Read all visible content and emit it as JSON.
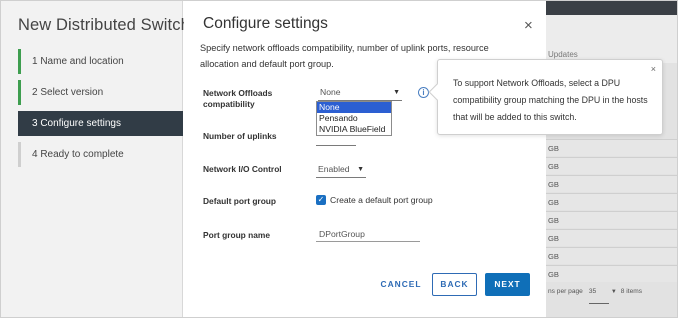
{
  "wizard": {
    "title": "New Distributed Switch",
    "steps": [
      {
        "label": "1  Name and location"
      },
      {
        "label": "2  Select version"
      },
      {
        "label": "3  Configure settings"
      },
      {
        "label": "4  Ready to complete"
      }
    ]
  },
  "dialog": {
    "title": "Configure settings",
    "close_glyph": "×",
    "description": "Specify network offloads compatibility, number of uplink ports, resource allocation and default port group."
  },
  "form": {
    "offloads": {
      "label": "Network Offloads compatibility",
      "value": "None",
      "options": [
        "None",
        "Pensando",
        "NVIDIA BlueField"
      ]
    },
    "uplinks": {
      "label": "Number of uplinks"
    },
    "io_control": {
      "label": "Network I/O Control",
      "value": "Enabled"
    },
    "default_port_group": {
      "label": "Default port group",
      "checkbox_label": "Create a default port group",
      "checked": true
    },
    "port_group_name": {
      "label": "Port group name",
      "value": "DPortGroup"
    }
  },
  "popover": {
    "text": "To support Network Offloads, select a DPU compatibility group matching the DPU in the hosts that will be added to this switch.",
    "close_glyph": "×"
  },
  "buttons": {
    "cancel": "CANCEL",
    "back": "BACK",
    "next": "NEXT"
  },
  "background": {
    "updates": "Updates",
    "rows": [
      "GB",
      "GB",
      "GB",
      "GB",
      "GB",
      "GB",
      "GB",
      "GB"
    ],
    "footer_text": "ns per page",
    "page_size": "35",
    "footer_tail": "8 items"
  },
  "colors": {
    "accent": "#0f6fb8",
    "active_step": "#313c46",
    "completed_step": "#3e9e4f"
  }
}
